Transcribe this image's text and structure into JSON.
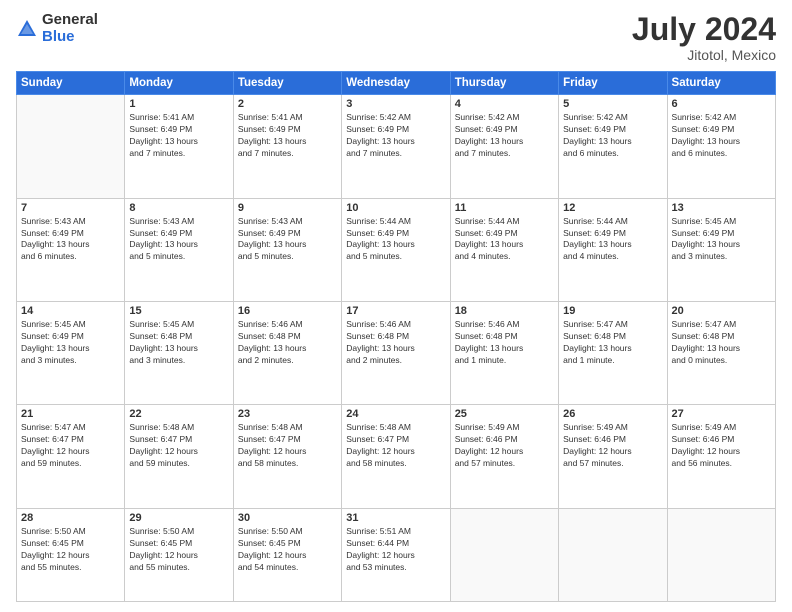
{
  "logo": {
    "general": "General",
    "blue": "Blue"
  },
  "header": {
    "month": "July 2024",
    "location": "Jitotol, Mexico"
  },
  "days_of_week": [
    "Sunday",
    "Monday",
    "Tuesday",
    "Wednesday",
    "Thursday",
    "Friday",
    "Saturday"
  ],
  "weeks": [
    [
      {
        "day": "",
        "info": ""
      },
      {
        "day": "1",
        "info": "Sunrise: 5:41 AM\nSunset: 6:49 PM\nDaylight: 13 hours\nand 7 minutes."
      },
      {
        "day": "2",
        "info": "Sunrise: 5:41 AM\nSunset: 6:49 PM\nDaylight: 13 hours\nand 7 minutes."
      },
      {
        "day": "3",
        "info": "Sunrise: 5:42 AM\nSunset: 6:49 PM\nDaylight: 13 hours\nand 7 minutes."
      },
      {
        "day": "4",
        "info": "Sunrise: 5:42 AM\nSunset: 6:49 PM\nDaylight: 13 hours\nand 7 minutes."
      },
      {
        "day": "5",
        "info": "Sunrise: 5:42 AM\nSunset: 6:49 PM\nDaylight: 13 hours\nand 6 minutes."
      },
      {
        "day": "6",
        "info": "Sunrise: 5:42 AM\nSunset: 6:49 PM\nDaylight: 13 hours\nand 6 minutes."
      }
    ],
    [
      {
        "day": "7",
        "info": "Sunrise: 5:43 AM\nSunset: 6:49 PM\nDaylight: 13 hours\nand 6 minutes."
      },
      {
        "day": "8",
        "info": "Sunrise: 5:43 AM\nSunset: 6:49 PM\nDaylight: 13 hours\nand 5 minutes."
      },
      {
        "day": "9",
        "info": "Sunrise: 5:43 AM\nSunset: 6:49 PM\nDaylight: 13 hours\nand 5 minutes."
      },
      {
        "day": "10",
        "info": "Sunrise: 5:44 AM\nSunset: 6:49 PM\nDaylight: 13 hours\nand 5 minutes."
      },
      {
        "day": "11",
        "info": "Sunrise: 5:44 AM\nSunset: 6:49 PM\nDaylight: 13 hours\nand 4 minutes."
      },
      {
        "day": "12",
        "info": "Sunrise: 5:44 AM\nSunset: 6:49 PM\nDaylight: 13 hours\nand 4 minutes."
      },
      {
        "day": "13",
        "info": "Sunrise: 5:45 AM\nSunset: 6:49 PM\nDaylight: 13 hours\nand 3 minutes."
      }
    ],
    [
      {
        "day": "14",
        "info": "Sunrise: 5:45 AM\nSunset: 6:49 PM\nDaylight: 13 hours\nand 3 minutes."
      },
      {
        "day": "15",
        "info": "Sunrise: 5:45 AM\nSunset: 6:48 PM\nDaylight: 13 hours\nand 3 minutes."
      },
      {
        "day": "16",
        "info": "Sunrise: 5:46 AM\nSunset: 6:48 PM\nDaylight: 13 hours\nand 2 minutes."
      },
      {
        "day": "17",
        "info": "Sunrise: 5:46 AM\nSunset: 6:48 PM\nDaylight: 13 hours\nand 2 minutes."
      },
      {
        "day": "18",
        "info": "Sunrise: 5:46 AM\nSunset: 6:48 PM\nDaylight: 13 hours\nand 1 minute."
      },
      {
        "day": "19",
        "info": "Sunrise: 5:47 AM\nSunset: 6:48 PM\nDaylight: 13 hours\nand 1 minute."
      },
      {
        "day": "20",
        "info": "Sunrise: 5:47 AM\nSunset: 6:48 PM\nDaylight: 13 hours\nand 0 minutes."
      }
    ],
    [
      {
        "day": "21",
        "info": "Sunrise: 5:47 AM\nSunset: 6:47 PM\nDaylight: 12 hours\nand 59 minutes."
      },
      {
        "day": "22",
        "info": "Sunrise: 5:48 AM\nSunset: 6:47 PM\nDaylight: 12 hours\nand 59 minutes."
      },
      {
        "day": "23",
        "info": "Sunrise: 5:48 AM\nSunset: 6:47 PM\nDaylight: 12 hours\nand 58 minutes."
      },
      {
        "day": "24",
        "info": "Sunrise: 5:48 AM\nSunset: 6:47 PM\nDaylight: 12 hours\nand 58 minutes."
      },
      {
        "day": "25",
        "info": "Sunrise: 5:49 AM\nSunset: 6:46 PM\nDaylight: 12 hours\nand 57 minutes."
      },
      {
        "day": "26",
        "info": "Sunrise: 5:49 AM\nSunset: 6:46 PM\nDaylight: 12 hours\nand 57 minutes."
      },
      {
        "day": "27",
        "info": "Sunrise: 5:49 AM\nSunset: 6:46 PM\nDaylight: 12 hours\nand 56 minutes."
      }
    ],
    [
      {
        "day": "28",
        "info": "Sunrise: 5:50 AM\nSunset: 6:45 PM\nDaylight: 12 hours\nand 55 minutes."
      },
      {
        "day": "29",
        "info": "Sunrise: 5:50 AM\nSunset: 6:45 PM\nDaylight: 12 hours\nand 55 minutes."
      },
      {
        "day": "30",
        "info": "Sunrise: 5:50 AM\nSunset: 6:45 PM\nDaylight: 12 hours\nand 54 minutes."
      },
      {
        "day": "31",
        "info": "Sunrise: 5:51 AM\nSunset: 6:44 PM\nDaylight: 12 hours\nand 53 minutes."
      },
      {
        "day": "",
        "info": ""
      },
      {
        "day": "",
        "info": ""
      },
      {
        "day": "",
        "info": ""
      }
    ]
  ]
}
